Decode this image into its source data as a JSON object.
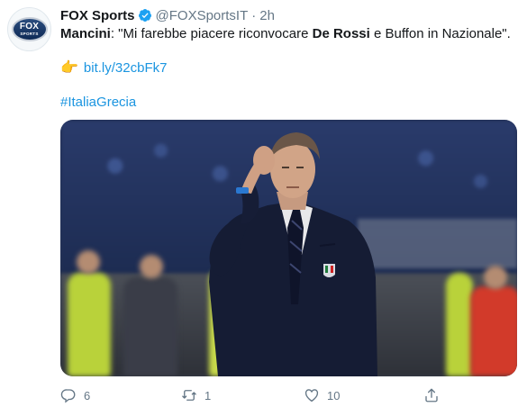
{
  "tweet": {
    "author_name": "FOX Sports",
    "handle": "@FOXSportsIT",
    "separator": "·",
    "time": "2h",
    "text_parts": {
      "p1": "Mancini",
      "p2": ": \"Mi farebbe piacere riconvocare ",
      "p3": "De Rossi",
      "p4": " e Buffon in Nazionale\"."
    },
    "link_emoji": "👉",
    "link": "bit.ly/32cbFk7",
    "hashtag": "#ItaliaGrecia",
    "avatar_logo": {
      "line1": "FOX",
      "line2": "SPORTS"
    }
  },
  "actions": {
    "replies": "6",
    "retweets": "1",
    "likes": "10"
  },
  "icons": {
    "verified": "verified-badge-icon",
    "reply": "reply-icon",
    "retweet": "retweet-icon",
    "like": "heart-icon",
    "share": "share-icon"
  },
  "colors": {
    "link": "#1b95e0",
    "muted": "#657786",
    "verified": "#1da1f2"
  }
}
